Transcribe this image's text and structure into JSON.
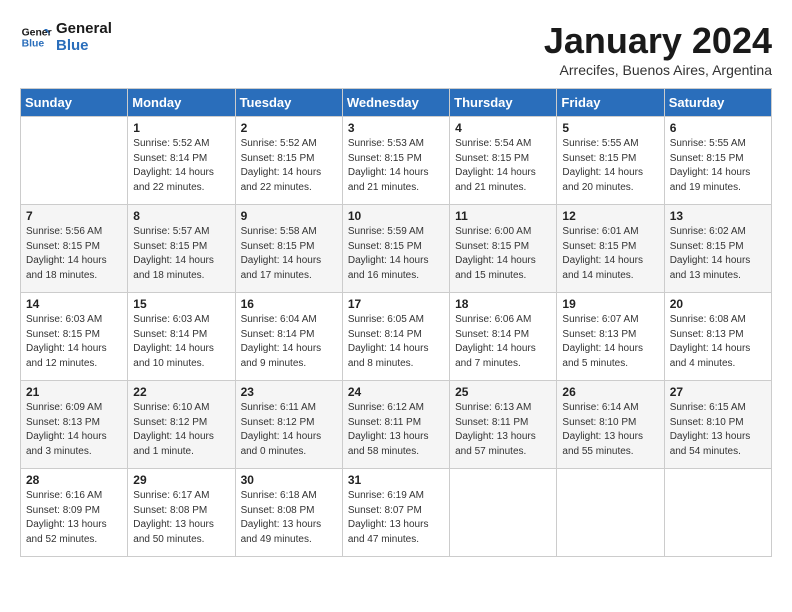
{
  "header": {
    "logo_line1": "General",
    "logo_line2": "Blue",
    "month_title": "January 2024",
    "subtitle": "Arrecifes, Buenos Aires, Argentina"
  },
  "weekdays": [
    "Sunday",
    "Monday",
    "Tuesday",
    "Wednesday",
    "Thursday",
    "Friday",
    "Saturday"
  ],
  "weeks": [
    [
      {
        "day": "",
        "info": ""
      },
      {
        "day": "1",
        "info": "Sunrise: 5:52 AM\nSunset: 8:14 PM\nDaylight: 14 hours\nand 22 minutes."
      },
      {
        "day": "2",
        "info": "Sunrise: 5:52 AM\nSunset: 8:15 PM\nDaylight: 14 hours\nand 22 minutes."
      },
      {
        "day": "3",
        "info": "Sunrise: 5:53 AM\nSunset: 8:15 PM\nDaylight: 14 hours\nand 21 minutes."
      },
      {
        "day": "4",
        "info": "Sunrise: 5:54 AM\nSunset: 8:15 PM\nDaylight: 14 hours\nand 21 minutes."
      },
      {
        "day": "5",
        "info": "Sunrise: 5:55 AM\nSunset: 8:15 PM\nDaylight: 14 hours\nand 20 minutes."
      },
      {
        "day": "6",
        "info": "Sunrise: 5:55 AM\nSunset: 8:15 PM\nDaylight: 14 hours\nand 19 minutes."
      }
    ],
    [
      {
        "day": "7",
        "info": "Sunrise: 5:56 AM\nSunset: 8:15 PM\nDaylight: 14 hours\nand 18 minutes."
      },
      {
        "day": "8",
        "info": "Sunrise: 5:57 AM\nSunset: 8:15 PM\nDaylight: 14 hours\nand 18 minutes."
      },
      {
        "day": "9",
        "info": "Sunrise: 5:58 AM\nSunset: 8:15 PM\nDaylight: 14 hours\nand 17 minutes."
      },
      {
        "day": "10",
        "info": "Sunrise: 5:59 AM\nSunset: 8:15 PM\nDaylight: 14 hours\nand 16 minutes."
      },
      {
        "day": "11",
        "info": "Sunrise: 6:00 AM\nSunset: 8:15 PM\nDaylight: 14 hours\nand 15 minutes."
      },
      {
        "day": "12",
        "info": "Sunrise: 6:01 AM\nSunset: 8:15 PM\nDaylight: 14 hours\nand 14 minutes."
      },
      {
        "day": "13",
        "info": "Sunrise: 6:02 AM\nSunset: 8:15 PM\nDaylight: 14 hours\nand 13 minutes."
      }
    ],
    [
      {
        "day": "14",
        "info": "Sunrise: 6:03 AM\nSunset: 8:15 PM\nDaylight: 14 hours\nand 12 minutes."
      },
      {
        "day": "15",
        "info": "Sunrise: 6:03 AM\nSunset: 8:14 PM\nDaylight: 14 hours\nand 10 minutes."
      },
      {
        "day": "16",
        "info": "Sunrise: 6:04 AM\nSunset: 8:14 PM\nDaylight: 14 hours\nand 9 minutes."
      },
      {
        "day": "17",
        "info": "Sunrise: 6:05 AM\nSunset: 8:14 PM\nDaylight: 14 hours\nand 8 minutes."
      },
      {
        "day": "18",
        "info": "Sunrise: 6:06 AM\nSunset: 8:14 PM\nDaylight: 14 hours\nand 7 minutes."
      },
      {
        "day": "19",
        "info": "Sunrise: 6:07 AM\nSunset: 8:13 PM\nDaylight: 14 hours\nand 5 minutes."
      },
      {
        "day": "20",
        "info": "Sunrise: 6:08 AM\nSunset: 8:13 PM\nDaylight: 14 hours\nand 4 minutes."
      }
    ],
    [
      {
        "day": "21",
        "info": "Sunrise: 6:09 AM\nSunset: 8:13 PM\nDaylight: 14 hours\nand 3 minutes."
      },
      {
        "day": "22",
        "info": "Sunrise: 6:10 AM\nSunset: 8:12 PM\nDaylight: 14 hours\nand 1 minute."
      },
      {
        "day": "23",
        "info": "Sunrise: 6:11 AM\nSunset: 8:12 PM\nDaylight: 14 hours\nand 0 minutes."
      },
      {
        "day": "24",
        "info": "Sunrise: 6:12 AM\nSunset: 8:11 PM\nDaylight: 13 hours\nand 58 minutes."
      },
      {
        "day": "25",
        "info": "Sunrise: 6:13 AM\nSunset: 8:11 PM\nDaylight: 13 hours\nand 57 minutes."
      },
      {
        "day": "26",
        "info": "Sunrise: 6:14 AM\nSunset: 8:10 PM\nDaylight: 13 hours\nand 55 minutes."
      },
      {
        "day": "27",
        "info": "Sunrise: 6:15 AM\nSunset: 8:10 PM\nDaylight: 13 hours\nand 54 minutes."
      }
    ],
    [
      {
        "day": "28",
        "info": "Sunrise: 6:16 AM\nSunset: 8:09 PM\nDaylight: 13 hours\nand 52 minutes."
      },
      {
        "day": "29",
        "info": "Sunrise: 6:17 AM\nSunset: 8:08 PM\nDaylight: 13 hours\nand 50 minutes."
      },
      {
        "day": "30",
        "info": "Sunrise: 6:18 AM\nSunset: 8:08 PM\nDaylight: 13 hours\nand 49 minutes."
      },
      {
        "day": "31",
        "info": "Sunrise: 6:19 AM\nSunset: 8:07 PM\nDaylight: 13 hours\nand 47 minutes."
      },
      {
        "day": "",
        "info": ""
      },
      {
        "day": "",
        "info": ""
      },
      {
        "day": "",
        "info": ""
      }
    ]
  ]
}
